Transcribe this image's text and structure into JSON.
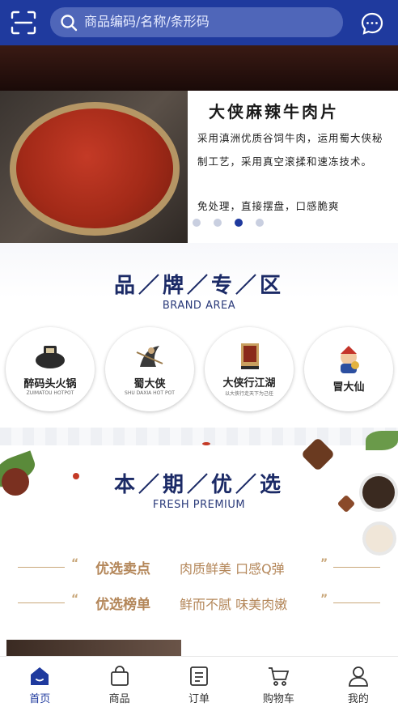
{
  "header": {
    "search_placeholder": "商品编码/名称/条形码"
  },
  "banner": {
    "title": "大侠麻辣牛肉片",
    "description": "采用滇洲优质谷饲牛肉，运用蜀大侠秘制工艺，采用真空滚揉和速冻技术。",
    "description_more": "免处理，直接摆盘，口感脆爽",
    "slide_count": 4,
    "active_slide": 3
  },
  "brand_area": {
    "title": "品／牌／专／区",
    "subtitle": "BRAND AREA",
    "brands": [
      {
        "name": "醉码头火锅",
        "sub": "ZUIMATOU HOTPOT"
      },
      {
        "name": "蜀大侠",
        "sub": "SHU DAXIA HOT POT"
      },
      {
        "name": "大侠行江湖",
        "sub": "以大侠行走天下为己任"
      },
      {
        "name": "冒大仙",
        "sub": ""
      }
    ]
  },
  "fresh_premium": {
    "title": "本／期／优／选",
    "subtitle": "FRESH PREMIUM",
    "features": [
      {
        "label": "优选卖点",
        "value": "肉质鲜美 口感Q弹"
      },
      {
        "label": "优选榜单",
        "value": "鲜而不腻 味美肉嫩"
      }
    ],
    "quote_open": "“",
    "quote_close": "”"
  },
  "tabbar": {
    "tabs": [
      {
        "label": "首页",
        "icon": "home-icon",
        "active": true
      },
      {
        "label": "商品",
        "icon": "bag-icon",
        "active": false
      },
      {
        "label": "订单",
        "icon": "order-icon",
        "active": false
      },
      {
        "label": "购物车",
        "icon": "cart-icon",
        "active": false
      },
      {
        "label": "我的",
        "icon": "user-icon",
        "active": false
      }
    ]
  },
  "colors": {
    "primary": "#1f3a9e",
    "accent_gold": "#b4875a"
  }
}
